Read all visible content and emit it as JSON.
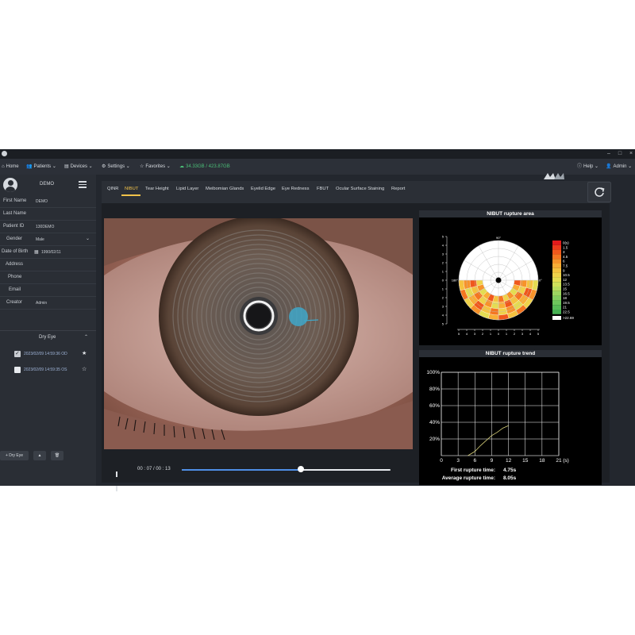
{
  "titlebar": {
    "app_name": ""
  },
  "menubar": {
    "home": "Home",
    "patients": "Patients",
    "devices": "Devices",
    "settings": "Settings",
    "favorites": "Favorites",
    "storage": "34.33GB / 423.87GB",
    "help": "Help",
    "admin": "Admin"
  },
  "patient": {
    "display_name": "DEMO",
    "fields": [
      {
        "label": "First Name",
        "value": "DEMO"
      },
      {
        "label": "Last Name",
        "value": ""
      },
      {
        "label": "Patient ID",
        "value": "130DEMO"
      },
      {
        "label": "Gender",
        "value": "Male"
      },
      {
        "label": "Date of Birth",
        "value": "1990/02/11"
      },
      {
        "label": "Address",
        "value": ""
      },
      {
        "label": "Phone",
        "value": ""
      },
      {
        "label": "Email",
        "value": ""
      },
      {
        "label": "Creator",
        "value": "Admin"
      }
    ]
  },
  "exams": {
    "group_label": "Dry Eye",
    "rows": [
      {
        "text": "2023/02/09 14:59:36  OD",
        "checked": true,
        "starred": true
      },
      {
        "text": "2023/02/09 14:59:35  OS",
        "checked": false,
        "starred": false
      }
    ],
    "add_button": "+ Dry Eye",
    "up_button": "▲",
    "delete_button": "🗑"
  },
  "tabs": [
    "QINR",
    "NIBUT",
    "Tear Height",
    "Lipid Layer",
    "Meibomian Glands",
    "Eyelid Edge",
    "Eye Redness",
    "FBUT",
    "Ocular Surface Staining",
    "Report"
  ],
  "active_tab": "NIBUT",
  "player": {
    "time": "00 : 07 / 00 : 13",
    "progress": 0.57
  },
  "area_chart": {
    "title": "NIBUT rupture area",
    "legend": [
      "0(s)",
      "1.5",
      "3",
      "4.5",
      "6",
      "7.5",
      "9",
      "10.5",
      "12",
      "13.5",
      "15",
      "16.5",
      "18",
      "19.5",
      "21",
      "22.5"
    ],
    "legend_colors": [
      "#e31a1c",
      "#ec3a1c",
      "#f0581c",
      "#f47621",
      "#f7932a",
      "#f9ad35",
      "#f5c23f",
      "#f0d24a",
      "#e4dc52",
      "#cfe05a",
      "#b6dc5e",
      "#9dd660",
      "#84cf5f",
      "#6dc55c",
      "#58bb57",
      "#46b052"
    ],
    "over_label": ">22.69",
    "polar_top": "90°",
    "polar_left": "180°",
    "polar_right": "0°",
    "y_ticks": [
      "5",
      "4",
      "3",
      "2",
      "1",
      "0",
      "1",
      "2",
      "3",
      "4",
      "5"
    ],
    "x_ticks": [
      "5",
      "4",
      "3",
      "2",
      "1",
      "0",
      "1",
      "2",
      "3",
      "4",
      "5"
    ]
  },
  "chart_data": {
    "type": "line",
    "title": "NIBUT rupture trend",
    "x_ticks": [
      "0",
      "3",
      "6",
      "9",
      "12",
      "15",
      "18",
      "21"
    ],
    "x_unit": "(s)",
    "y_ticks": [
      "20%",
      "40%",
      "60%",
      "80%",
      "100%"
    ],
    "xlim": [
      0,
      21
    ],
    "ylim": [
      0,
      100
    ],
    "series": [
      {
        "x": [
          4.75,
          6,
          7,
          8,
          9,
          10,
          11,
          12
        ],
        "y": [
          0,
          5,
          12,
          18,
          24,
          28,
          33,
          36
        ]
      }
    ],
    "stats": [
      {
        "label": "First rupture time:",
        "value": "4.75s"
      },
      {
        "label": "Average rupture time:",
        "value": "8.05s"
      }
    ]
  }
}
